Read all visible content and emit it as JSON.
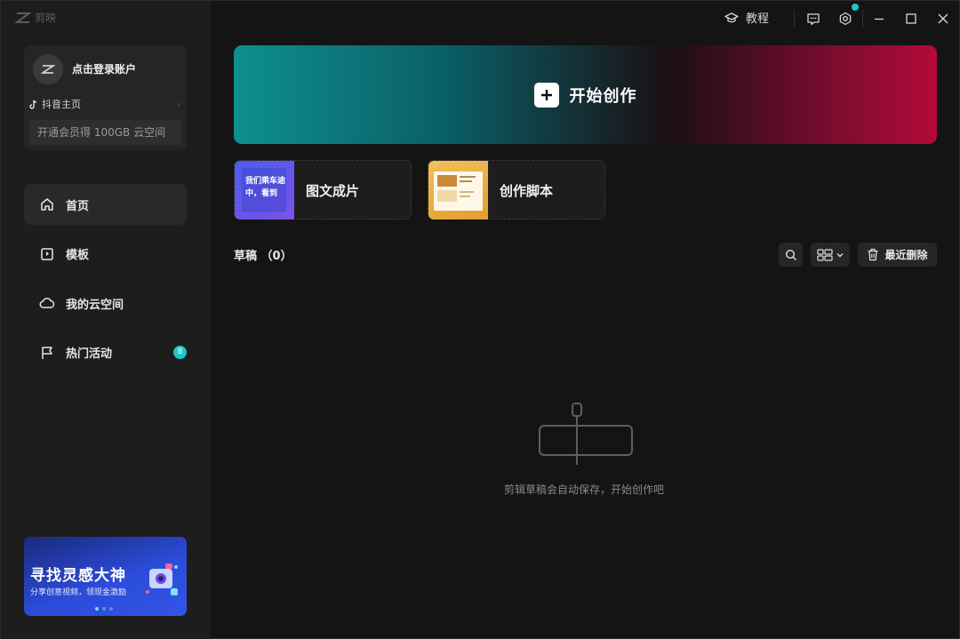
{
  "app": {
    "name": "剪映"
  },
  "account": {
    "login_text": "点击登录账户",
    "douyin_label": "抖音主页",
    "vip_text": "开通会员得 100GB 云空间"
  },
  "nav": {
    "items": [
      {
        "label": "首页",
        "icon": "home-icon",
        "active": true
      },
      {
        "label": "模板",
        "icon": "template-icon"
      },
      {
        "label": "我的云空间",
        "icon": "cloud-icon"
      },
      {
        "label": "热门活动",
        "icon": "flag-icon",
        "badge": "8"
      }
    ]
  },
  "promo": {
    "title": "寻找灵感大神",
    "subtitle": "分享创意视频，领现金激励"
  },
  "topbar": {
    "tutorial_label": "教程"
  },
  "main": {
    "create_label": "开始创作",
    "features": [
      {
        "label": "图文成片",
        "thumb_text": "我们乘车途中，看到"
      },
      {
        "label": "创作脚本"
      }
    ],
    "drafts_label": "草稿 （0）",
    "recently_deleted_label": "最近删除",
    "empty_text": "剪辑草稿会自动保存，开始创作吧"
  },
  "colors": {
    "accent": "#20c5c9",
    "background": "#141414",
    "sidebar": "#1d1d1e"
  }
}
